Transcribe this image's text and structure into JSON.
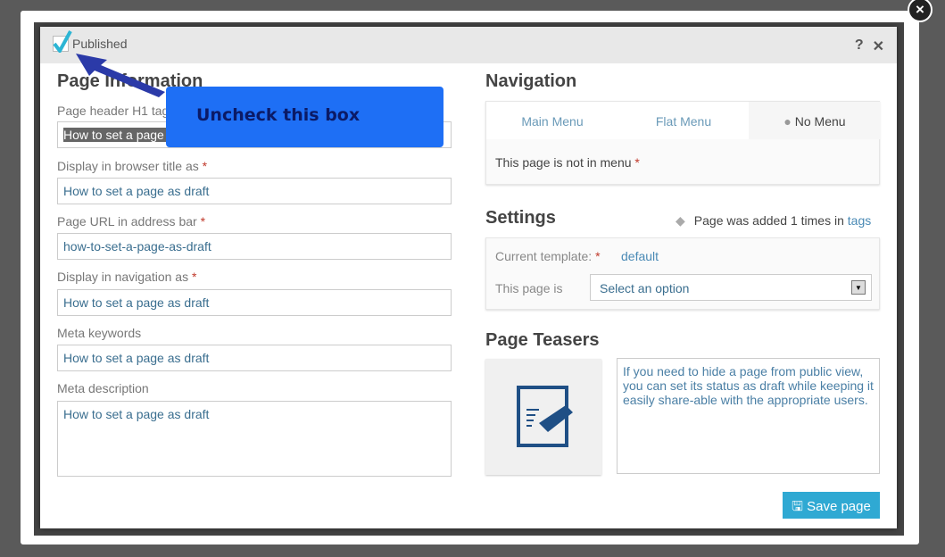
{
  "header": {
    "published_label": "Published",
    "published_checked": true,
    "help": "?",
    "close": "✕"
  },
  "page_info": {
    "title": "Page Information",
    "fields": [
      {
        "label": "Page header H1 tag",
        "required": "*",
        "value": "How to set a page as draft"
      },
      {
        "label": "Display in browser title as",
        "required": "*",
        "value": "How to set a page as draft"
      },
      {
        "label": "Page URL in address bar",
        "required": "*",
        "value": "how-to-set-a-page-as-draft"
      },
      {
        "label": "Display in navigation as",
        "required": "*",
        "value": "How to set a page as draft"
      },
      {
        "label": "Meta keywords",
        "required": "",
        "value": "How to set a page as draft"
      },
      {
        "label": "Meta description",
        "required": "",
        "value": "How to set a page as draft"
      }
    ]
  },
  "callout": {
    "text": "Uncheck this box",
    "color": "#1e6ff5"
  },
  "navigation": {
    "title": "Navigation",
    "tabs": [
      {
        "label": "Main Menu"
      },
      {
        "label": "Flat Menu"
      },
      {
        "label": "No Menu",
        "active": true
      }
    ],
    "body": "This page is not in menu",
    "required": "*"
  },
  "settings": {
    "title": "Settings",
    "tags_text": "Page was added 1 times in",
    "tags_link": "tags",
    "template_label": "Current template:",
    "required": "*",
    "template_value": "default",
    "status_label": "This page is",
    "status_placeholder": "Select an option"
  },
  "teasers": {
    "title": "Page Teasers",
    "text": "If you need to hide a page from public view, you can set its status as draft while keeping it easily share-able with the appropriate users."
  },
  "save_label": "Save page",
  "overlay_close": "×",
  "colors": {
    "accent": "#2fa9d3",
    "link": "#4a8ab5",
    "icon": "#1f4f85"
  }
}
